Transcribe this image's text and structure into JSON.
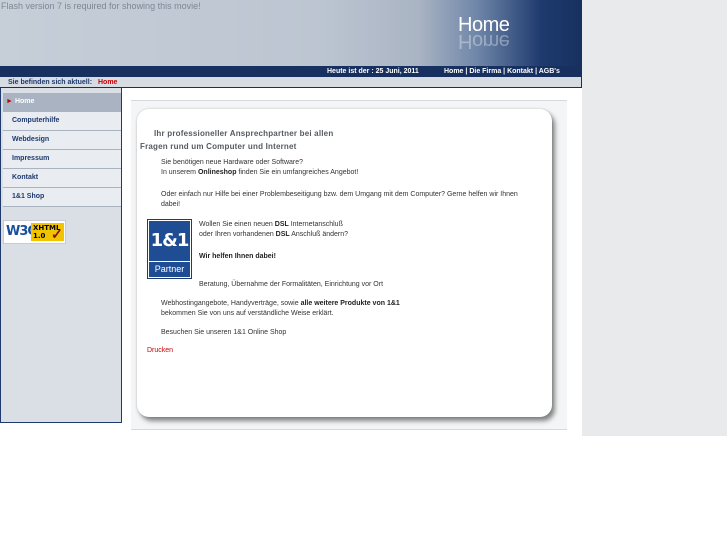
{
  "header": {
    "flash_message": "Flash version 7 is required for showing this movie!",
    "home_title": "Home",
    "date_text": "Heute ist der : 25 Juni, 2011",
    "top_links": [
      "Home",
      "Die Firma",
      "Kontakt",
      "AGB's"
    ],
    "separator": " | "
  },
  "breadcrumb": {
    "label": "Sie befinden sich aktuell:",
    "current": "Home"
  },
  "sidebar": {
    "items": [
      {
        "label": "Home",
        "active": true
      },
      {
        "label": "Computerhilfe",
        "active": false
      },
      {
        "label": "Webdesign",
        "active": false
      },
      {
        "label": "Impressum",
        "active": false
      },
      {
        "label": "Kontakt",
        "active": false
      },
      {
        "label": "1&1 Shop",
        "active": false
      }
    ],
    "badge": {
      "left": "W3C",
      "right_line1": "XHTML",
      "right_line2": "1.0",
      "check": "✓"
    }
  },
  "content": {
    "heading_line1": "Ihr professioneller Ansprechpartner bei allen",
    "heading_line2": "Fragen rund um Computer und Internet",
    "p1_line1": "Sie benötigen neue Hardware oder Software?",
    "p1_line2_pre": "In unserem ",
    "p1_line2_bold": "Onlineshop",
    "p1_line2_post": " finden Sie ein umfangreiches Angebot!",
    "p2_line1": "Oder einfach nur Hilfe bei einer Problembeseitigung bzw. dem Umgang mit dem Computer? Gerne helfen wir Ihnen",
    "p2_line2": "dabei!",
    "p3_line1_pre": "Wollen Sie einen neuen ",
    "p3_line1_bold": "DSL",
    "p3_line1_post": " Internetanschluß",
    "p3_line2_pre": "oder Ihren vorhandenen ",
    "p3_line2_bold": "DSL",
    "p3_line2_post": " Anschluß ändern?",
    "p3_line3": "Wir helfen Ihnen dabei!",
    "p4": "Beratung, Übernahme der Formalitäten, Einrichtung vor Ort",
    "p5_line1_pre": "Webhostingangebote, Handyverträge, sowie ",
    "p5_line1_bold": "alle weitere Produkte von 1&1",
    "p5_line2": "bekommen Sie von uns auf verständliche Weise erklärt.",
    "p6": "Besuchen Sie unseren 1&1 Online Shop",
    "partner_top": "1&1",
    "partner_bottom": "Partner",
    "print_link": "Drucken"
  }
}
